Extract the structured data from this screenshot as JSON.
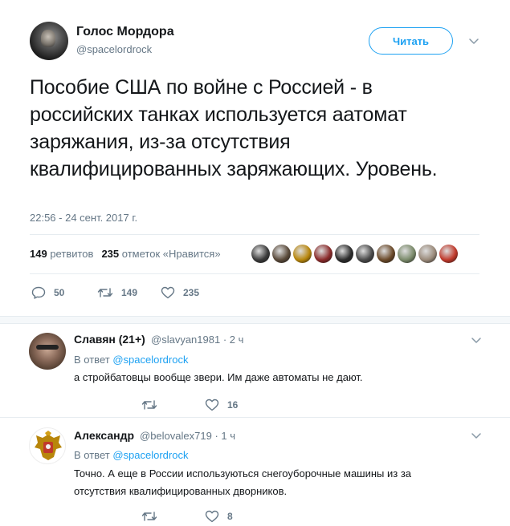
{
  "main_tweet": {
    "author_name": "Голос Мордора",
    "author_handle": "@spacelordrock",
    "follow_label": "Читать",
    "text": "Пособие США по войне с Россией - в российских танках используется аатомат заряжания, из-за отсутствия квалифицированных заряжающих. Уровень.",
    "date": "22:56 - 24 сент. 2017 г.",
    "stats": {
      "retweets_count": "149",
      "retweets_label": "ретвитов",
      "likes_count": "235",
      "likes_label": "отметок «Нравится»"
    },
    "likers": [
      "#3b3b3b",
      "#5a4a3a",
      "#b8860b",
      "#8b2b2b",
      "#2d2d2d",
      "#4a4a4a",
      "#6b4a2a",
      "#7a8a6a",
      "#9a8a7a",
      "#c0392b"
    ],
    "actions": {
      "replies": "50",
      "retweets": "149",
      "likes": "235"
    }
  },
  "replies": [
    {
      "name": "Славян (21+)",
      "handle": "@slavyan1981",
      "time": "· 2 ч",
      "reply_prefix": "В ответ",
      "reply_to": "@spacelordrock",
      "text": "а стройбатовцы вообще звери. Им даже автоматы не дают.",
      "retweets": "",
      "likes": "16"
    },
    {
      "name": "Александр",
      "handle": "@belovalex719",
      "time": "· 1 ч",
      "reply_prefix": "В ответ",
      "reply_to": "@spacelordrock",
      "text": "Точно. А еще в России используються снегоуборочные машины из за отсутствия квалифицированных дворников.",
      "retweets": "",
      "likes": "8"
    }
  ],
  "colors": {
    "accent": "#1da1f2",
    "muted": "#657786",
    "text": "#14171a",
    "divider": "#e6ecf0",
    "like_hover": "#e0245e"
  }
}
